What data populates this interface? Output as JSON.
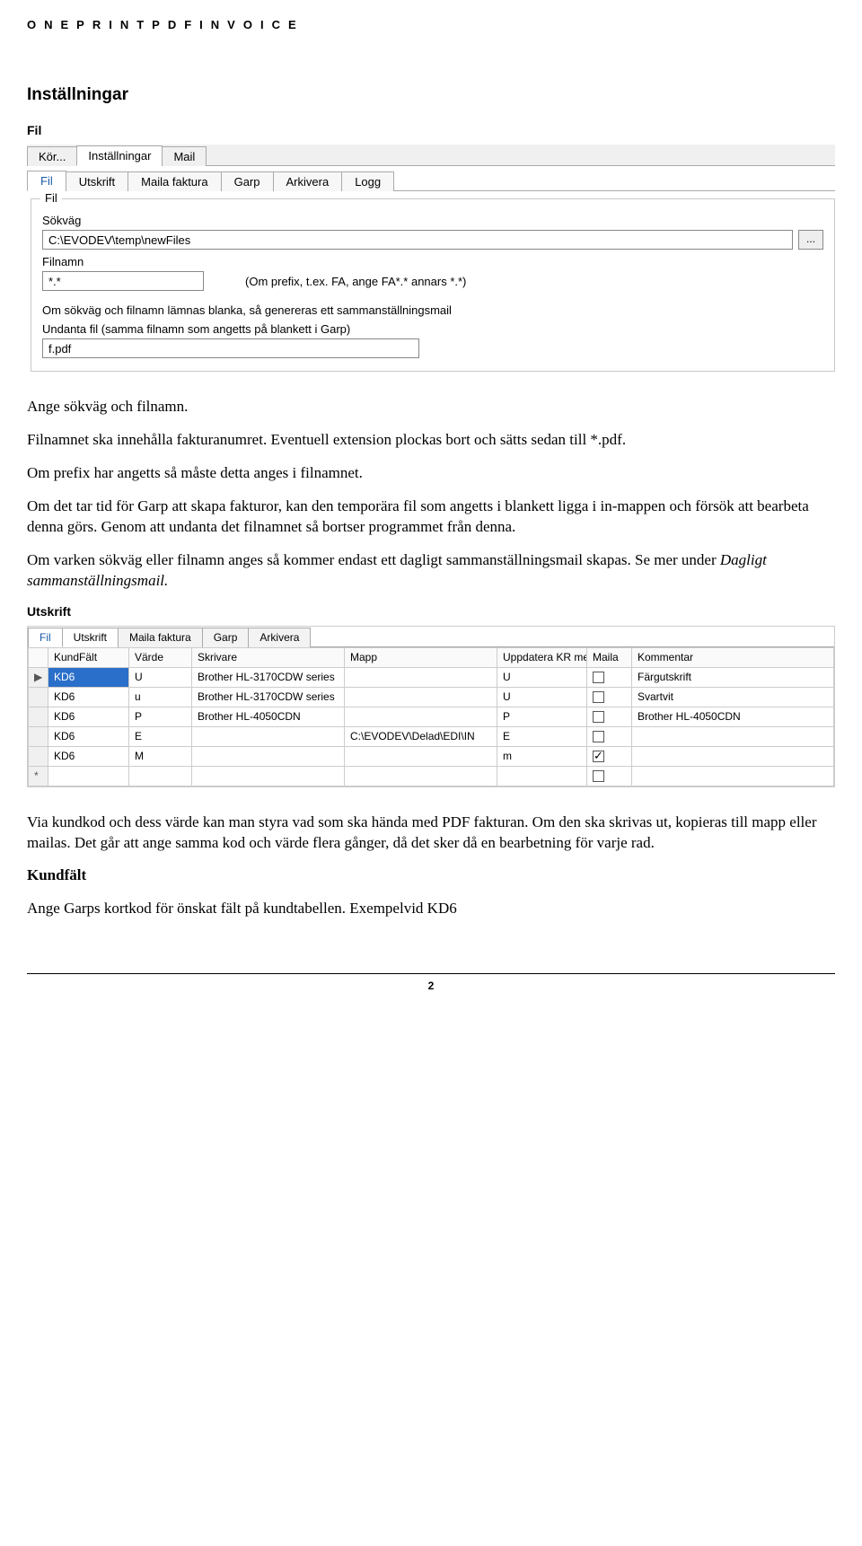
{
  "header_letters": "ONEPRINTPDFINVOICE",
  "section_title": "Inställningar",
  "sub_fil": "Fil",
  "shot1": {
    "main_tabs": [
      "Kör...",
      "Inställningar",
      "Mail"
    ],
    "main_active": 1,
    "sub_tabs": [
      "Fil",
      "Utskrift",
      "Maila faktura",
      "Garp",
      "Arkivera",
      "Logg"
    ],
    "sub_active": 0,
    "group_legend": "Fil",
    "label_sokvag": "Sökväg",
    "value_sokvag": "C:\\EVODEV\\temp\\newFiles",
    "browse_label": "...",
    "label_filnamn": "Filnamn",
    "value_filnamn": "*.*",
    "hint_filnamn": "(Om prefix, t.ex. FA, ange FA*.* annars *.*)",
    "note1": "Om sökväg och filnamn lämnas blanka, så genereras ett sammanställningsmail",
    "label_undanta": "Undanta fil (samma filnamn som angetts på blankett i Garp)",
    "value_undanta": "f.pdf"
  },
  "para1": "Ange sökväg och filnamn.",
  "para2": "Filnamnet ska innehålla fakturanumret. Eventuell extension plockas bort och sätts sedan till *.pdf.",
  "para3": "Om prefix har angetts så måste detta anges i filnamnet.",
  "para4": "Om det tar tid för Garp att skapa fakturor, kan den temporära fil som angetts i blankett ligga i in-mappen och försök att bearbeta denna görs. Genom att undanta det filnamnet så bortser programmet från denna.",
  "para5a": "Om varken sökväg eller filnamn anges så kommer endast ett dagligt sammanställningsmail skapas. Se mer under ",
  "para5b": "Dagligt sammanställningsmail.",
  "sub_utskrift": "Utskrift",
  "shot2": {
    "tabs": [
      "Fil",
      "Utskrift",
      "Maila faktura",
      "Garp",
      "Arkivera"
    ],
    "active": 1,
    "columns": [
      "KundFält",
      "Värde",
      "Skrivare",
      "Mapp",
      "Uppdatera KR med",
      "Maila",
      "Kommentar"
    ],
    "rows": [
      {
        "marker": "▶",
        "selected_col0": true,
        "kundfalt": "KD6",
        "varde": "U",
        "skrivare": "Brother HL-3170CDW series",
        "mapp": "",
        "uppd": "U",
        "maila": false,
        "komm": "Färgutskrift"
      },
      {
        "marker": "",
        "kundfalt": "KD6",
        "varde": "u",
        "skrivare": "Brother HL-3170CDW series",
        "mapp": "",
        "uppd": "U",
        "maila": false,
        "komm": "Svartvit"
      },
      {
        "marker": "",
        "kundfalt": "KD6",
        "varde": "P",
        "skrivare": "Brother HL-4050CDN",
        "mapp": "",
        "uppd": "P",
        "maila": false,
        "komm": "Brother HL-4050CDN"
      },
      {
        "marker": "",
        "kundfalt": "KD6",
        "varde": "E",
        "skrivare": "",
        "mapp": "C:\\EVODEV\\Delad\\EDI\\IN",
        "uppd": "E",
        "maila": false,
        "komm": ""
      },
      {
        "marker": "",
        "kundfalt": "KD6",
        "varde": "M",
        "skrivare": "",
        "mapp": "",
        "uppd": "m",
        "maila": true,
        "komm": ""
      },
      {
        "marker": "*",
        "kundfalt": "",
        "varde": "",
        "skrivare": "",
        "mapp": "",
        "uppd": "",
        "maila": false,
        "komm": ""
      }
    ]
  },
  "para6": "Via kundkod och dess värde kan man styra vad som ska hända med PDF fakturan. Om den ska skrivas ut, kopieras till mapp eller mailas. Det går att ange samma kod och värde flera gånger, då det sker då en bearbetning för varje rad.",
  "sub_kundfalt": "Kundfält",
  "para7": "Ange Garps kortkod för önskat fält på kundtabellen. Exempelvid KD6",
  "page_num": "2"
}
